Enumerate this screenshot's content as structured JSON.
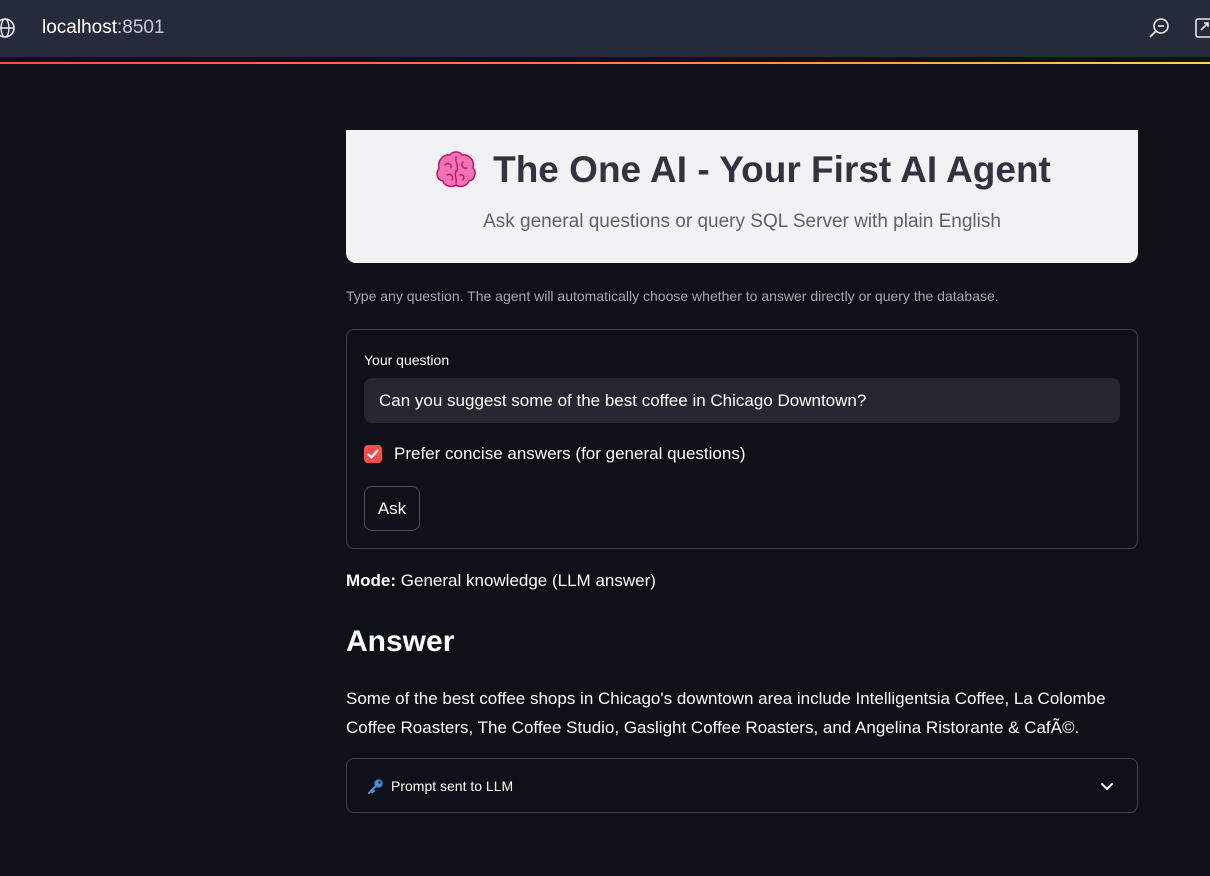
{
  "browser": {
    "host": "localhost",
    "port": ":8501"
  },
  "hero": {
    "icon": "brain-icon",
    "title": "The One AI - Your First AI Agent",
    "subtitle": "Ask general questions or query SQL Server with plain English"
  },
  "hint": "Type any question. The agent will automatically choose whether to answer directly or query the database.",
  "form": {
    "question_label": "Your question",
    "question_value": "Can you suggest some of the best coffee in Chicago Downtown?",
    "concise_label": "Prefer concise answers (for general questions)",
    "concise_checked": true,
    "ask_label": "Ask"
  },
  "mode": {
    "label": "Mode:",
    "value": "General knowledge (LLM answer)"
  },
  "answer": {
    "heading": "Answer",
    "text": "Some of the best coffee shops in Chicago's downtown area include Intelligentsia Coffee, La Colombe Coffee Roasters, The Coffee Studio, Gaslight Coffee Roasters, and Angelina Ristorante & CafÃ©."
  },
  "expander": {
    "icon": "key-icon",
    "label": "Prompt sent to LLM"
  },
  "colors": {
    "background": "#0e1117",
    "accent": "#ff4b4b",
    "hero_bg": "#f0f2f6"
  }
}
